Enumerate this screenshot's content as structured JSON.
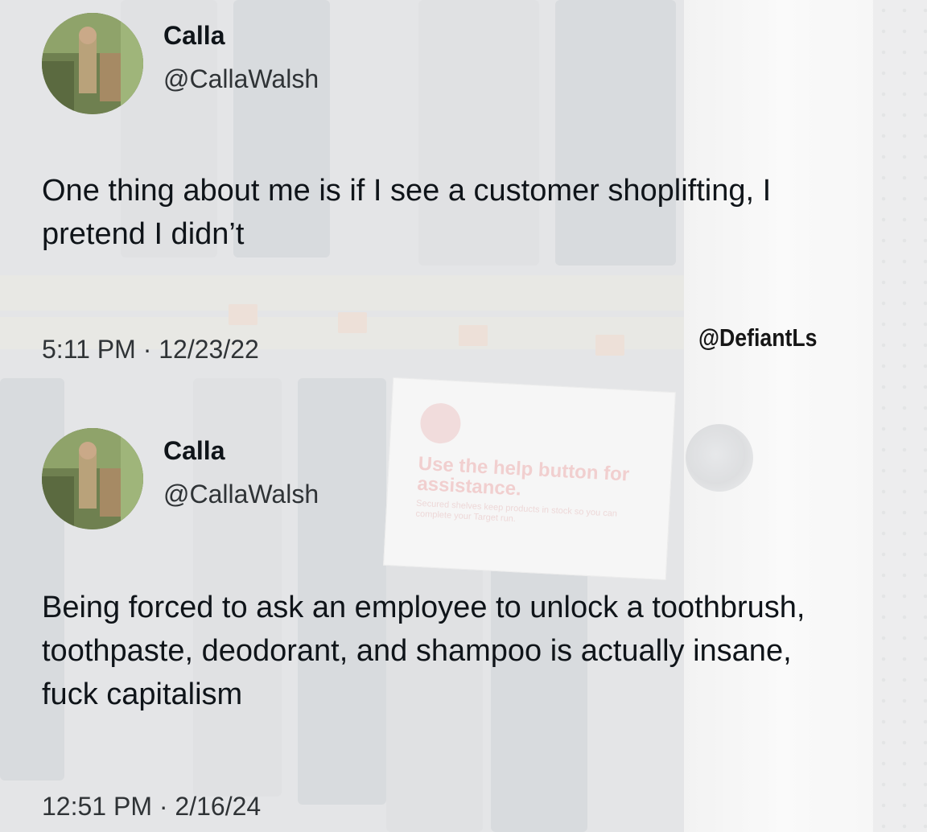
{
  "background": {
    "sign": {
      "title": "Use the help button for assistance.",
      "subtitle": "Secured shelves keep products in stock so you can complete your Target run."
    }
  },
  "tweets": [
    {
      "name": "Calla",
      "handle": "@CallaWalsh",
      "text": "One thing about me is if I see a customer shoplifting, I pretend I didn’t",
      "timestamp": "5:11 PM · 12/23/22"
    },
    {
      "name": "Calla",
      "handle": "@CallaWalsh",
      "text": "Being forced to ask an employee to unlock a toothbrush, toothpaste, deodorant, and shampoo is actually insane, fuck capitalism",
      "timestamp": "12:51 PM · 2/16/24"
    }
  ],
  "watermark": "@DefiantLs"
}
